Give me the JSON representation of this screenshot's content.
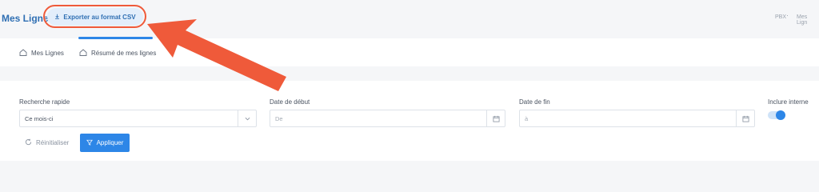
{
  "header": {
    "title": "Mes Lignes",
    "export_label": "Exporter au format CSV",
    "breadcrumb": [
      "PBX",
      "Mes Lign"
    ]
  },
  "tabs": [
    {
      "label": "Mes Lignes",
      "icon": "home-icon"
    },
    {
      "label": "Résumé de mes lignes",
      "icon": "home-icon"
    }
  ],
  "filters": {
    "quick_search": {
      "label": "Recherche rapide",
      "value": "Ce mois-ci"
    },
    "start_date": {
      "label": "Date de début",
      "placeholder": "De"
    },
    "end_date": {
      "label": "Date de fin",
      "placeholder": "à"
    },
    "include_internal": {
      "label": "Inclure interne",
      "checked": true
    }
  },
  "actions": {
    "reset_label": "Réinitialiser",
    "apply_label": "Appliquer"
  },
  "annotation": {
    "color": "#ef5a3a"
  }
}
